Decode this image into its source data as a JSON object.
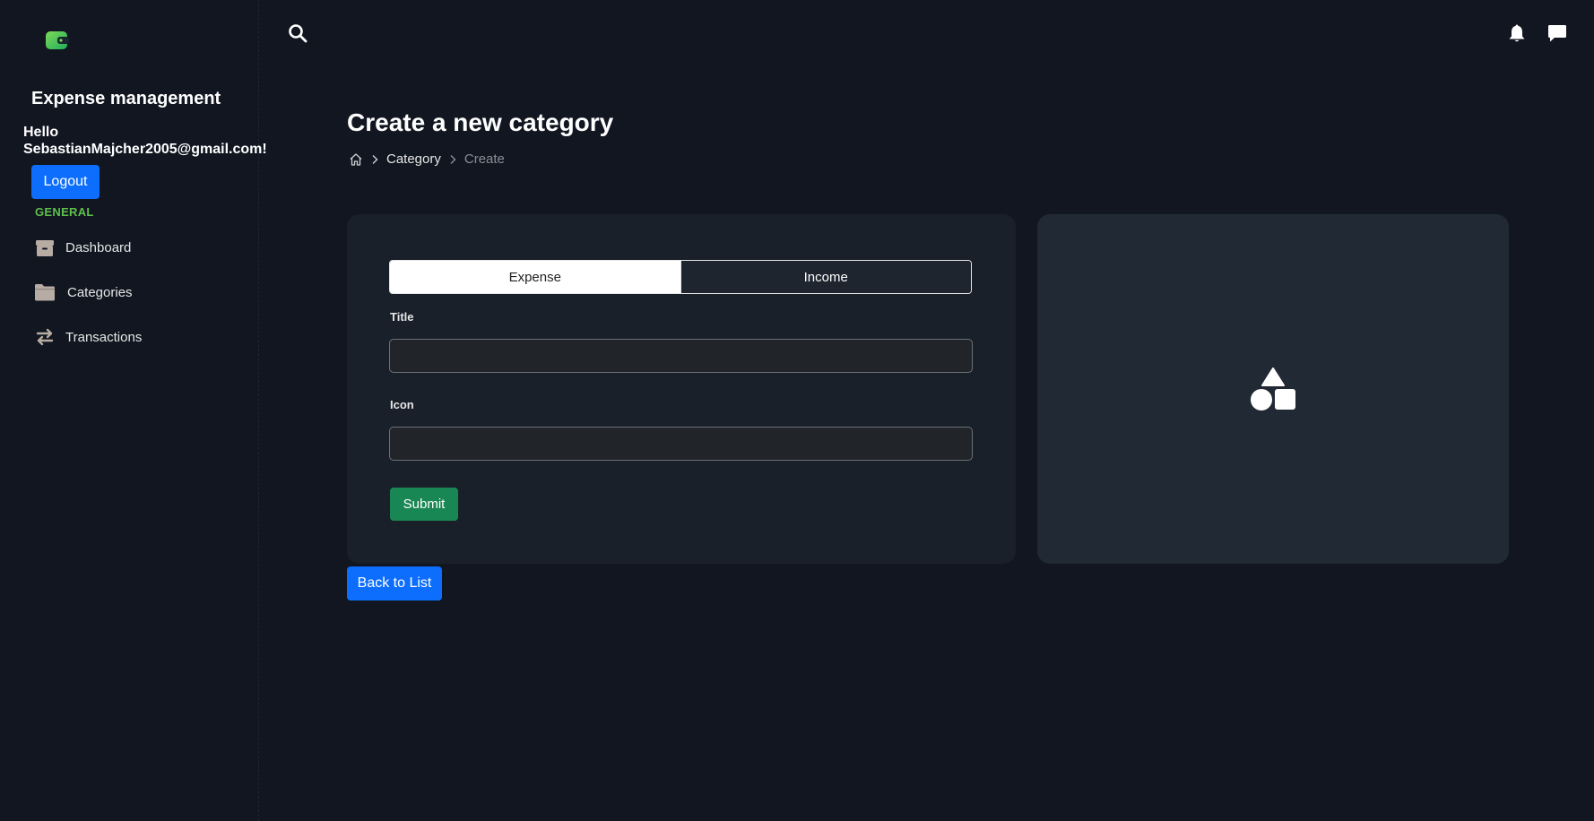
{
  "sidebar": {
    "app_title": "Expense management",
    "greeting_line1": "Hello",
    "greeting_line2": "SebastianMajcher2005@gmail.com!",
    "logout_label": "Logout",
    "section_label": "GENERAL",
    "items": [
      {
        "label": "Dashboard",
        "icon": "box-icon"
      },
      {
        "label": "Categories",
        "icon": "folder-icon"
      },
      {
        "label": "Transactions",
        "icon": "arrows-exchange-icon"
      }
    ]
  },
  "topbar": {
    "icons": [
      "search-icon",
      "bell-icon",
      "chat-icon"
    ]
  },
  "main": {
    "page_title": "Create a new category",
    "breadcrumb": [
      "Category",
      "Create"
    ],
    "form": {
      "toggle_options": [
        "Expense",
        "Income"
      ],
      "selected_type": "Expense",
      "title_label": "Title",
      "title_value": "",
      "icon_label": "Icon",
      "icon_value": "",
      "submit_label": "Submit"
    },
    "preview_icon": "shapes-icon",
    "back_label": "Back to List"
  },
  "colors": {
    "background": "#111620",
    "card": "#19202a",
    "preview_card": "#212934",
    "primary": "#0d6efd",
    "success": "#198754",
    "section_green": "#5ec04b"
  }
}
